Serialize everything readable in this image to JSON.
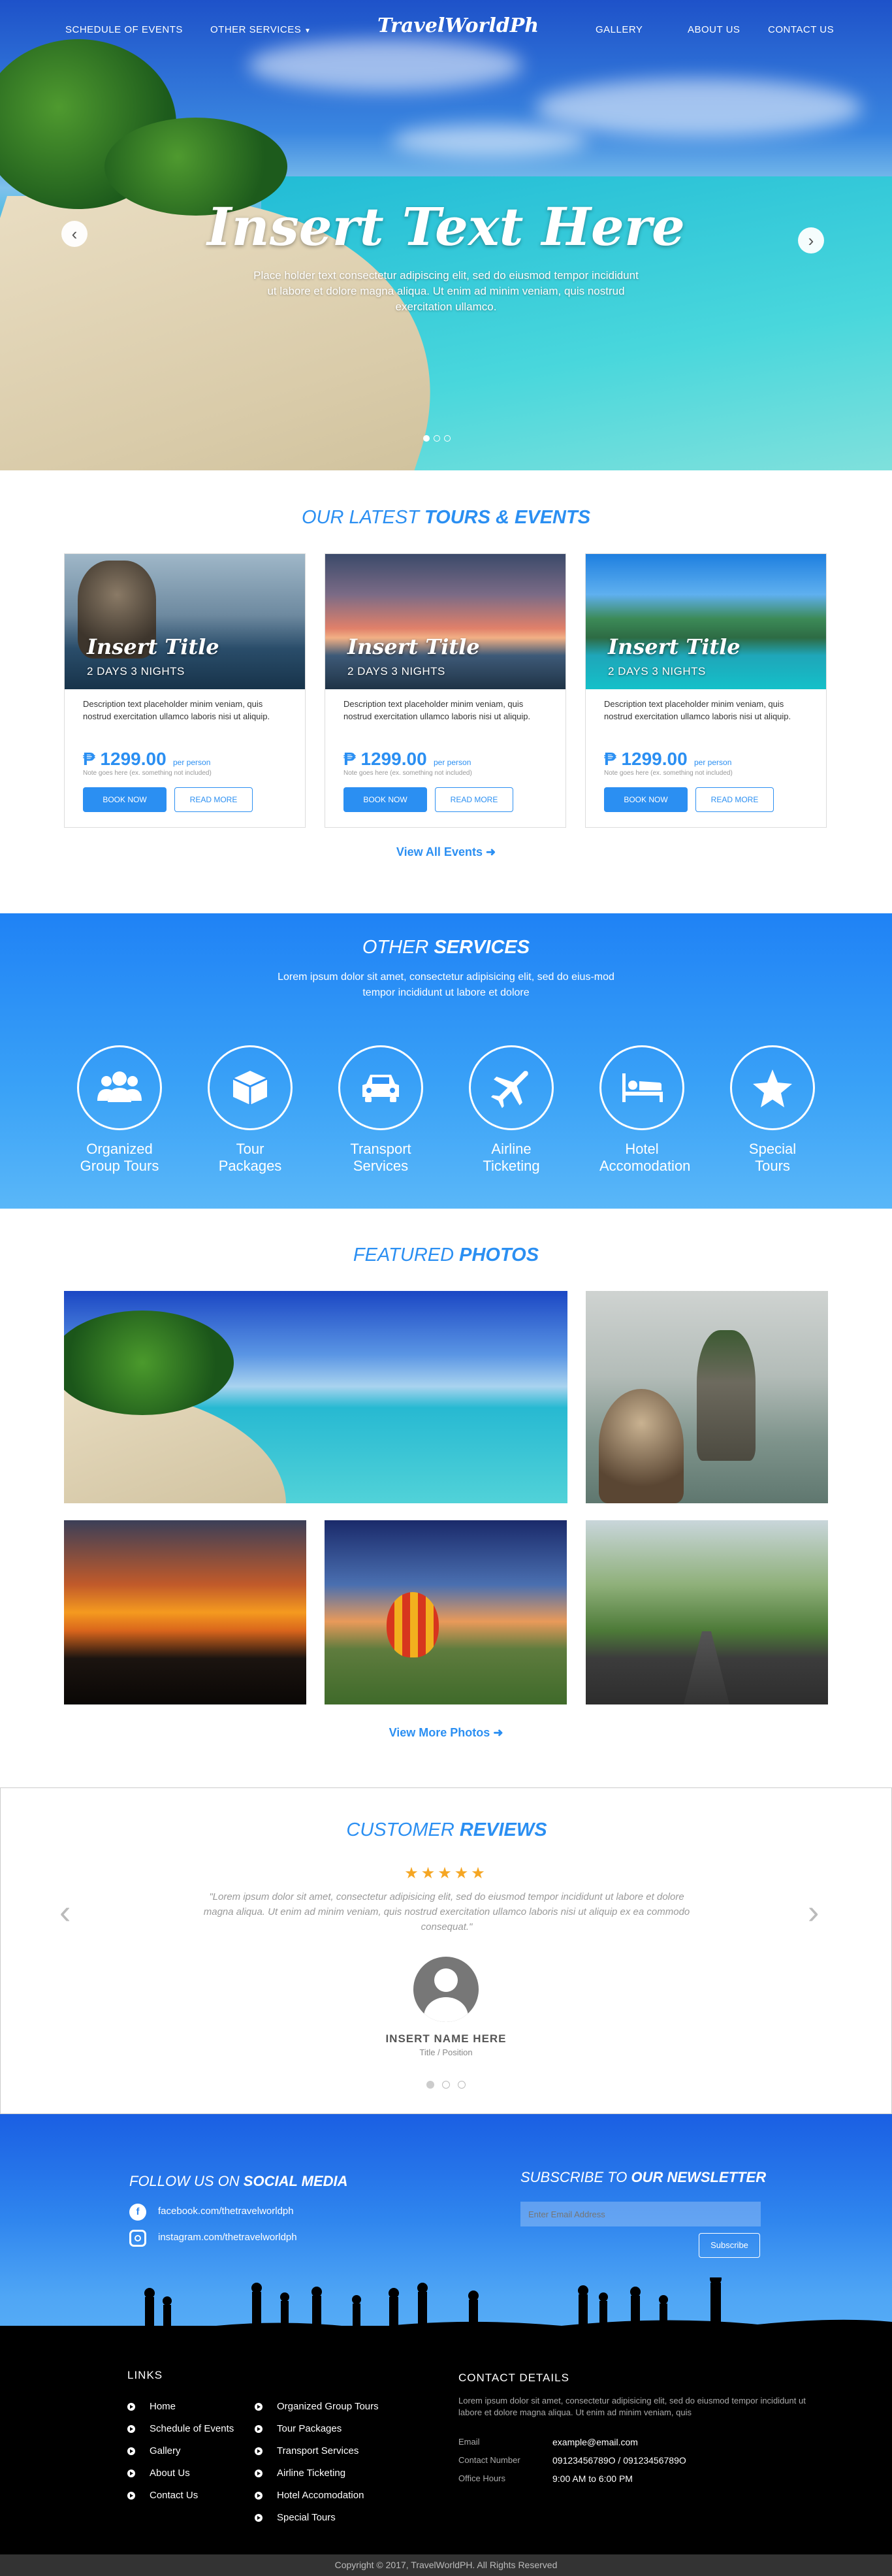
{
  "nav": {
    "left_items": [
      "SCHEDULE OF EVENTS",
      "OTHER SERVICES"
    ],
    "logo": "TravelWorldPh",
    "right_items": [
      "GALLERY",
      "ABOUT US",
      "CONTACT US"
    ]
  },
  "hero": {
    "title": "Insert Text Here",
    "text": "Place holder text consectetur adipiscing elit, sed do eiusmod tempor incididunt ut labore et dolore magna aliqua. Ut enim ad minim veniam, quis nostrud exercitation ullamco."
  },
  "tours": {
    "title_light": "OUR LATEST ",
    "title_bold": "TOURS & EVENTS",
    "cards": [
      {
        "title": "Insert Title",
        "sub": "2 DAYS 3 NIGHTS",
        "desc": "Description text placeholder minim veniam, quis nostrud exercitation ullamco laboris nisi ut aliquip.",
        "price": "₱ 1299.00",
        "per": "per person",
        "note": "Note goes here (ex. something not included)",
        "book": "BOOK NOW",
        "more": "READ MORE"
      },
      {
        "title": "Insert Title",
        "sub": "2 DAYS 3 NIGHTS",
        "desc": "Description text placeholder minim veniam, quis nostrud exercitation ullamco laboris nisi ut aliquip.",
        "price": "₱ 1299.00",
        "per": "per person",
        "note": "Note goes here (ex. something not included)",
        "book": "BOOK NOW",
        "more": "READ MORE"
      },
      {
        "title": "Insert Title",
        "sub": "2 DAYS 3 NIGHTS",
        "desc": "Description text placeholder minim veniam, quis nostrud exercitation ullamco laboris nisi ut aliquip.",
        "price": "₱ 1299.00",
        "per": "per person",
        "note": "Note goes here (ex. something not included)",
        "book": "BOOK NOW",
        "more": "READ MORE"
      }
    ],
    "view_all": "View All Events"
  },
  "services": {
    "title_light": "OTHER ",
    "title_bold": "SERVICES",
    "text": "Lorem ipsum dolor sit amet, consectetur adipisicing elit, sed do eius-mod tempor incididunt ut labore et dolore",
    "items": [
      {
        "label": "Organized Group Tours",
        "icon": "group-icon"
      },
      {
        "label": "Tour Packages",
        "icon": "package-icon"
      },
      {
        "label": "Transport Services",
        "icon": "car-icon"
      },
      {
        "label": "Airline Ticketing",
        "icon": "airplane-icon"
      },
      {
        "label": "Hotel Accomodation",
        "icon": "bed-icon"
      },
      {
        "label": "Special Tours",
        "icon": "star-icon"
      }
    ]
  },
  "photos": {
    "title_light": "FEATURED ",
    "title_bold": "PHOTOS",
    "view_more": "View More Photos"
  },
  "reviews": {
    "title_light": "CUSTOMER ",
    "title_bold": "REVIEWS",
    "rating": 5,
    "quote": "\"Lorem ipsum dolor sit amet, consectetur adipisicing elit, sed do eiusmod tempor incididunt ut labore et dolore magna aliqua. Ut enim ad minim veniam, quis nostrud exercitation ullamco laboris nisi ut aliquip ex ea commodo consequat.\"",
    "name": "INSERT NAME HERE",
    "position": "Title / Position"
  },
  "footer": {
    "follow_light": "FOLLOW US ON ",
    "follow_bold": "SOCIAL MEDIA",
    "facebook": "facebook.com/thetravelworldph",
    "instagram": "instagram.com/thetravelworldph",
    "subscribe_light": "SUBSCRIBE TO ",
    "subscribe_bold": "OUR NEWSLETTER",
    "email_placeholder": "Enter Email Address",
    "subscribe_btn": "Subscribe",
    "links_title": "LINKS",
    "links_col1": [
      "Home",
      "Schedule of Events",
      "Gallery",
      "About Us",
      "Contact Us"
    ],
    "links_col2": [
      "Organized Group Tours",
      "Tour Packages",
      "Transport Services",
      "Airline Ticketing",
      "Hotel Accomodation",
      "Special Tours"
    ],
    "contact_title": "CONTACT DETAILS",
    "contact_text": "Lorem ipsum dolor sit amet, consectetur adipisicing elit, sed do eiusmod tempor incididunt ut labore et dolore magna aliqua. Ut enim ad minim veniam, quis",
    "email_label": "Email",
    "email_value": "example@email.com",
    "phone_label": "Contact Number",
    "phone_value": "09123456789O / 09123456789O",
    "hours_label": "Office Hours",
    "hours_value": "9:00 AM to 6:00 PM",
    "copyright": "Copyright © 2017, TravelWorldPH. All Rights Reserved"
  },
  "colors": {
    "accent": "#2b8ff2",
    "star": "#f5a623"
  }
}
